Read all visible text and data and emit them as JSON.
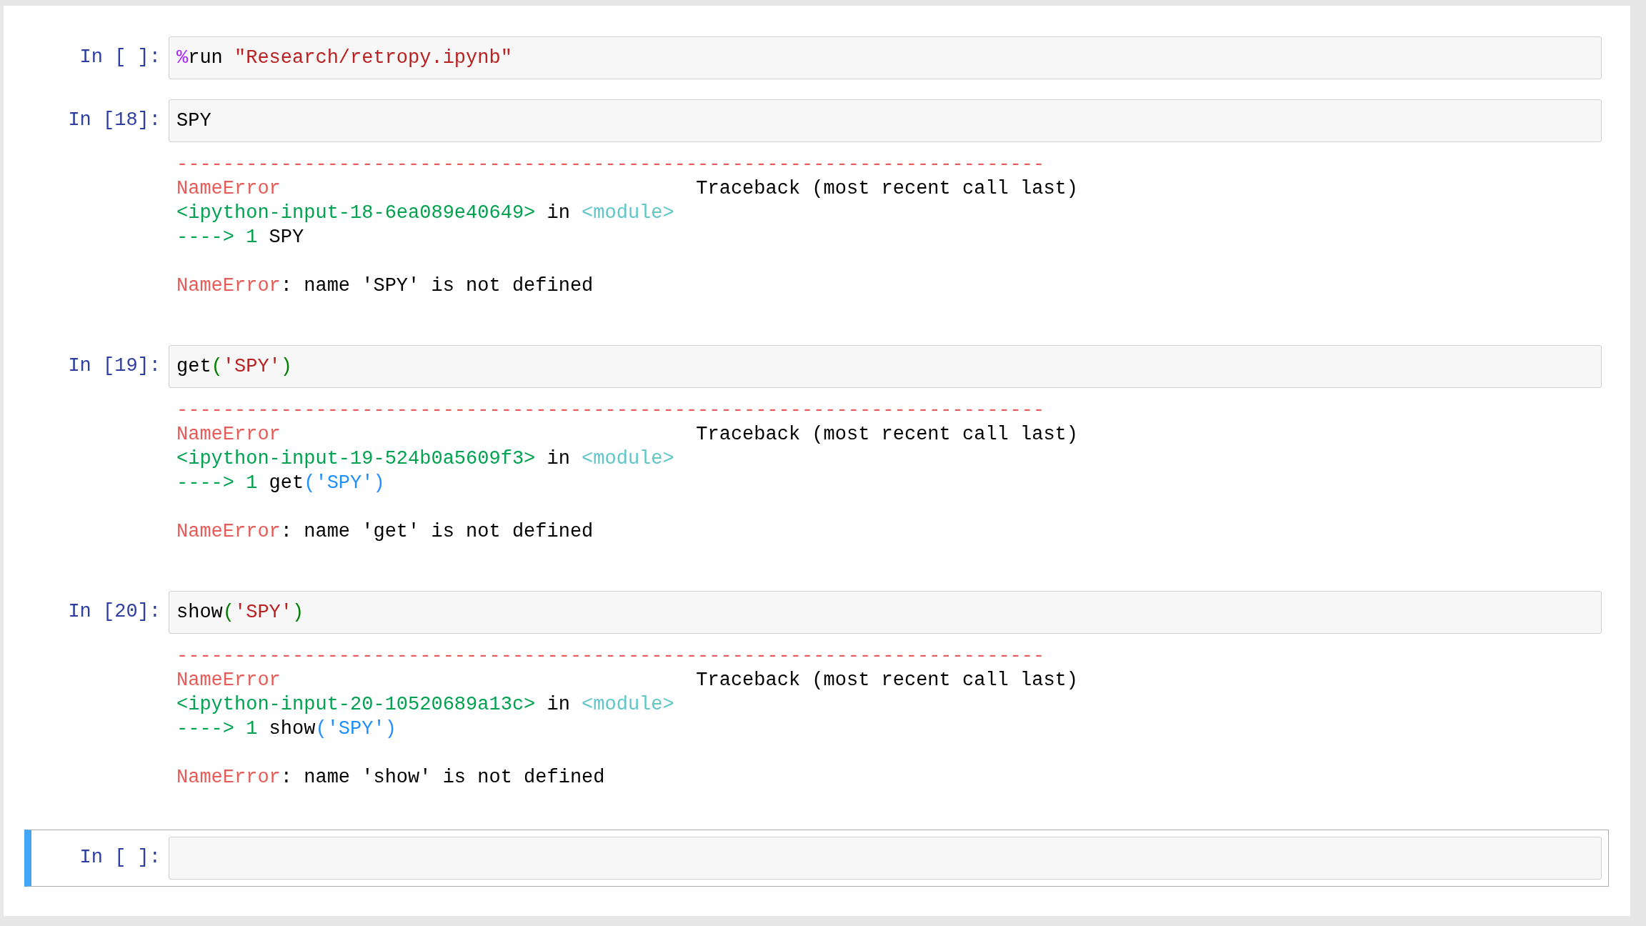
{
  "cells": [
    {
      "prompt": "In [ ]:",
      "selected": false,
      "code": [
        {
          "text": "%",
          "kind": "magic"
        },
        {
          "text": "run ",
          "kind": "plain"
        },
        {
          "text": "\"Research/retropy.ipynb\"",
          "kind": "string"
        }
      ]
    },
    {
      "prompt": "In [18]:",
      "selected": false,
      "code": [
        {
          "text": "SPY",
          "kind": "plain"
        }
      ],
      "output": [
        {
          "kind": "rule",
          "text": "---------------------------------------------------------------------------"
        },
        {
          "kind": "header",
          "left": "NameError",
          "right": "Traceback (most recent call last)"
        },
        {
          "kind": "segments",
          "segments": [
            {
              "text": "<ipython-input-18-6ea089e40649>",
              "kind": "green"
            },
            {
              "text": " in ",
              "kind": "plain"
            },
            {
              "text": "<module>",
              "kind": "cyan"
            }
          ]
        },
        {
          "kind": "segments",
          "segments": [
            {
              "text": "----> 1",
              "kind": "green"
            },
            {
              "text": " SPY",
              "kind": "plain"
            }
          ]
        },
        {
          "kind": "blank"
        },
        {
          "kind": "segments",
          "segments": [
            {
              "text": "NameError",
              "kind": "error"
            },
            {
              "text": ": name 'SPY' is not defined",
              "kind": "plain"
            }
          ]
        }
      ]
    },
    {
      "prompt": "In [19]:",
      "selected": false,
      "code": [
        {
          "text": "get",
          "kind": "plain"
        },
        {
          "text": "(",
          "kind": "punct"
        },
        {
          "text": "'SPY'",
          "kind": "string"
        },
        {
          "text": ")",
          "kind": "punct"
        }
      ],
      "output": [
        {
          "kind": "rule",
          "text": "---------------------------------------------------------------------------"
        },
        {
          "kind": "header",
          "left": "NameError",
          "right": "Traceback (most recent call last)"
        },
        {
          "kind": "segments",
          "segments": [
            {
              "text": "<ipython-input-19-524b0a5609f3>",
              "kind": "green"
            },
            {
              "text": " in ",
              "kind": "plain"
            },
            {
              "text": "<module>",
              "kind": "cyan"
            }
          ]
        },
        {
          "kind": "segments",
          "segments": [
            {
              "text": "----> 1",
              "kind": "green"
            },
            {
              "text": " get",
              "kind": "plain"
            },
            {
              "text": "('SPY')",
              "kind": "blue"
            }
          ]
        },
        {
          "kind": "blank"
        },
        {
          "kind": "segments",
          "segments": [
            {
              "text": "NameError",
              "kind": "error"
            },
            {
              "text": ": name 'get' is not defined",
              "kind": "plain"
            }
          ]
        }
      ]
    },
    {
      "prompt": "In [20]:",
      "selected": false,
      "code": [
        {
          "text": "show",
          "kind": "plain"
        },
        {
          "text": "(",
          "kind": "punct"
        },
        {
          "text": "'SPY'",
          "kind": "string"
        },
        {
          "text": ")",
          "kind": "punct"
        }
      ],
      "output": [
        {
          "kind": "rule",
          "text": "---------------------------------------------------------------------------"
        },
        {
          "kind": "header",
          "left": "NameError",
          "right": "Traceback (most recent call last)"
        },
        {
          "kind": "segments",
          "segments": [
            {
              "text": "<ipython-input-20-10520689a13c>",
              "kind": "green"
            },
            {
              "text": " in ",
              "kind": "plain"
            },
            {
              "text": "<module>",
              "kind": "cyan"
            }
          ]
        },
        {
          "kind": "segments",
          "segments": [
            {
              "text": "----> 1",
              "kind": "green"
            },
            {
              "text": " show",
              "kind": "plain"
            },
            {
              "text": "('SPY')",
              "kind": "blue"
            }
          ]
        },
        {
          "kind": "blank"
        },
        {
          "kind": "segments",
          "segments": [
            {
              "text": "NameError",
              "kind": "error"
            },
            {
              "text": ": name 'show' is not defined",
              "kind": "plain"
            }
          ]
        }
      ]
    },
    {
      "prompt": "In [ ]:",
      "selected": true
    }
  ]
}
